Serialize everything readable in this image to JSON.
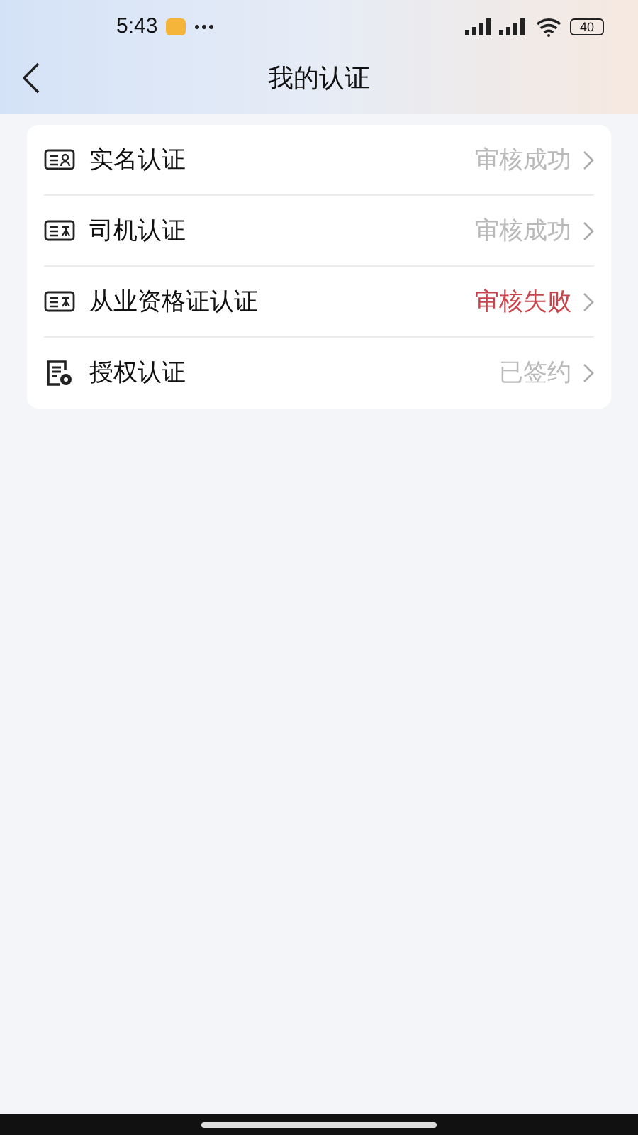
{
  "status_bar": {
    "time": "5:43",
    "battery": "40"
  },
  "nav": {
    "title": "我的认证"
  },
  "items": [
    {
      "label": "实名认证",
      "status": "审核成功",
      "kind": "success"
    },
    {
      "label": "司机认证",
      "status": "审核成功",
      "kind": "success"
    },
    {
      "label": "从业资格证认证",
      "status": "审核失败",
      "kind": "failed"
    },
    {
      "label": "授权认证",
      "status": "已签约",
      "kind": "signed"
    }
  ]
}
